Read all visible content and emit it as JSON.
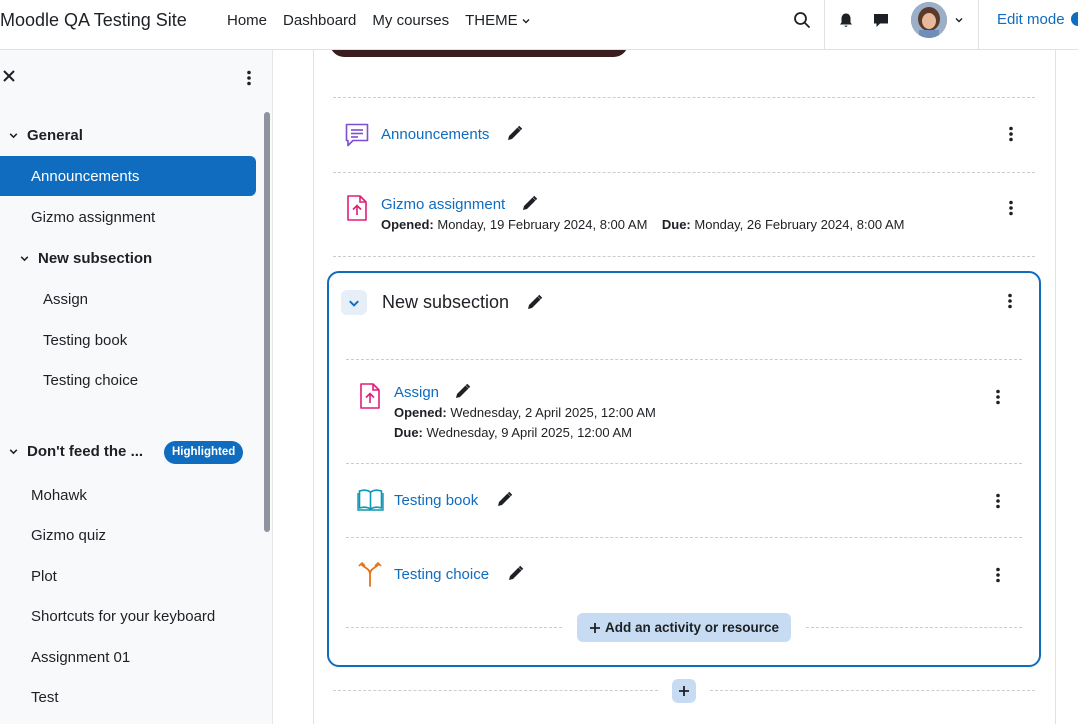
{
  "navbar": {
    "site_name": "Moodle QA Testing Site",
    "links": [
      "Home",
      "Dashboard",
      "My courses"
    ],
    "theme_menu": "THEME",
    "edit_mode_label": "Edit mode"
  },
  "course_index": {
    "sections": [
      {
        "title": "General",
        "items": [
          "Announcements",
          "Gizmo assignment"
        ],
        "subsection": {
          "title": "New subsection",
          "items": [
            "Assign",
            "Testing book",
            "Testing choice"
          ]
        }
      },
      {
        "title": "Don't feed the ...",
        "badge": "Highlighted",
        "items": [
          "Mohawk",
          "Gizmo quiz",
          "Plot",
          "Shortcuts for your keyboard",
          "Assignment 01",
          "Test"
        ]
      }
    ]
  },
  "main": {
    "activities": [
      {
        "name": "Announcements",
        "type": "forum"
      },
      {
        "name": "Gizmo assignment",
        "type": "assignment",
        "opened_label": "Opened:",
        "opened_value": "Monday, 19 February 2024, 8:00 AM",
        "due_label": "Due:",
        "due_value": "Monday, 26 February 2024, 8:00 AM"
      }
    ],
    "subsection": {
      "title": "New subsection",
      "activities": [
        {
          "name": "Assign",
          "type": "assignment",
          "opened_label": "Opened:",
          "opened_value": "Wednesday, 2 April 2025, 12:00 AM",
          "due_label": "Due:",
          "due_value": "Wednesday, 9 April 2025, 12:00 AM"
        },
        {
          "name": "Testing book",
          "type": "book"
        },
        {
          "name": "Testing choice",
          "type": "choice"
        }
      ],
      "add_label": "Add an activity or resource"
    }
  },
  "colors": {
    "primary": "#0f6cbf",
    "forum_icon": "#7e4dd2",
    "assign_icon": "#e31c79",
    "book_icon": "#0d97b4",
    "choice_icon": "#e67417"
  }
}
